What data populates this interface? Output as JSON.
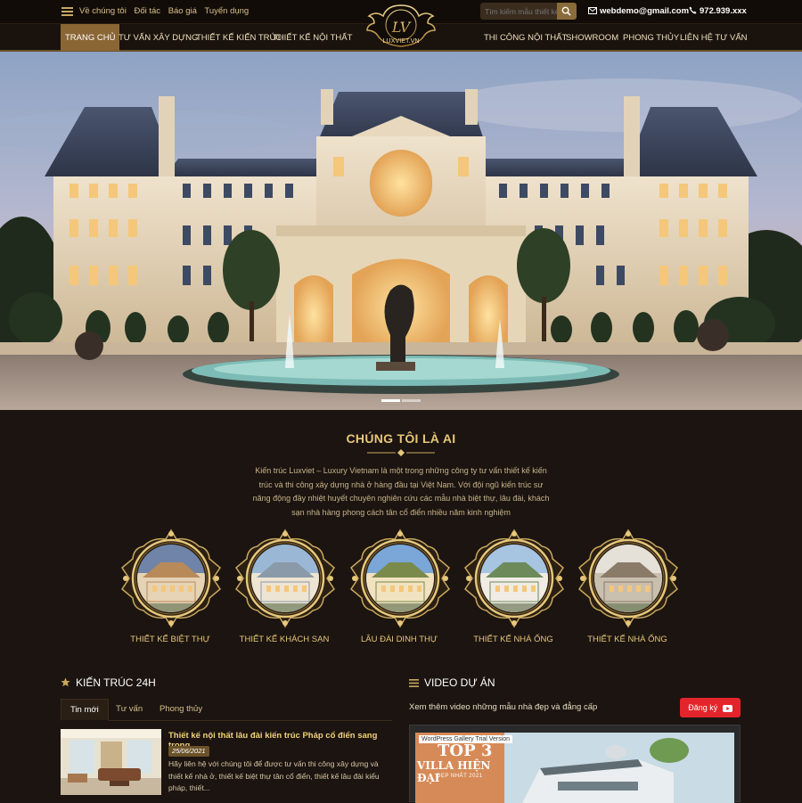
{
  "topbar": {
    "links": [
      "Về chúng tôi",
      "Đối tác",
      "Báo giá",
      "Tuyển dụng"
    ],
    "search_placeholder": "Tìm kiếm mẫu thiết kế",
    "email": "webdemo@gmail.com",
    "phone": "972.939.xxx"
  },
  "nav": {
    "left": [
      "Trang chủ",
      "Tư vấn xây dựng",
      "Thiết kế kiến trúc",
      "Thiết kế nội thất"
    ],
    "right": [
      "Thi công nội thất",
      "Showroom",
      "Phong thủy",
      "Liên hệ tư vấn"
    ],
    "active": "Trang chủ"
  },
  "logo": {
    "monogram": "LV",
    "name": "LUXVIET.VN"
  },
  "about": {
    "title": "CHÚNG TÔI LÀ AI",
    "text": "Kiến trúc Luxviet – Luxury Vietnam là một trong những công ty tư vấn thiết kế kiến trúc và thi công xây dựng nhà ở hàng đầu tại Việt Nam. Với đội ngũ kiến trúc sư năng động đầy nhiệt huyết chuyên nghiên cứu các mẫu nhà biệt thự, lâu đài, khách sạn nhà hàng phong cách tân cổ điển nhiều năm kinh nghiệm"
  },
  "categories": [
    {
      "label": "Thiết kế biệt thự"
    },
    {
      "label": "Thiết kế khách sạn"
    },
    {
      "label": "Lâu đài dinh thự"
    },
    {
      "label": "Thiết kế nhà ống"
    },
    {
      "label": "Thiết kế nhà ống"
    }
  ],
  "news": {
    "title": "KIẾN TRÚC 24H",
    "tabs": [
      "Tin mới",
      "Tư vấn",
      "Phong thủy"
    ],
    "active_tab": "Tin mới",
    "item": {
      "title": "Thiết kế nội thất lâu đài kiến trúc Pháp cổ điển sang trọng",
      "date": "25/06/2021",
      "excerpt": "Hãy liên hệ với chúng tôi để được tư vấn thi công xây dựng và thiết kế nhà ở, thiết kế biệt thự tân cổ điển, thiết kế lâu đài kiểu pháp, thiết..."
    }
  },
  "video": {
    "title": "VIDEO DỰ ÁN",
    "subtitle": "Xem thêm video những mẫu nhà đẹp và đẳng cấp",
    "subscribe_label": "Đăng ký",
    "watermark": "WordPress Gallery Trial Version",
    "thumb_line1": "TOP 3",
    "thumb_line2": "VILLA HIỆN ĐẠI",
    "thumb_line3": "ĐẸP NHẤT 2021"
  },
  "slider": {
    "slide_count": 2,
    "active_slide": 1
  },
  "colors": {
    "gold": "#e6c77b",
    "bg": "#1b1410",
    "nav_active": "#8a6635",
    "subscribe": "#e3242b"
  }
}
